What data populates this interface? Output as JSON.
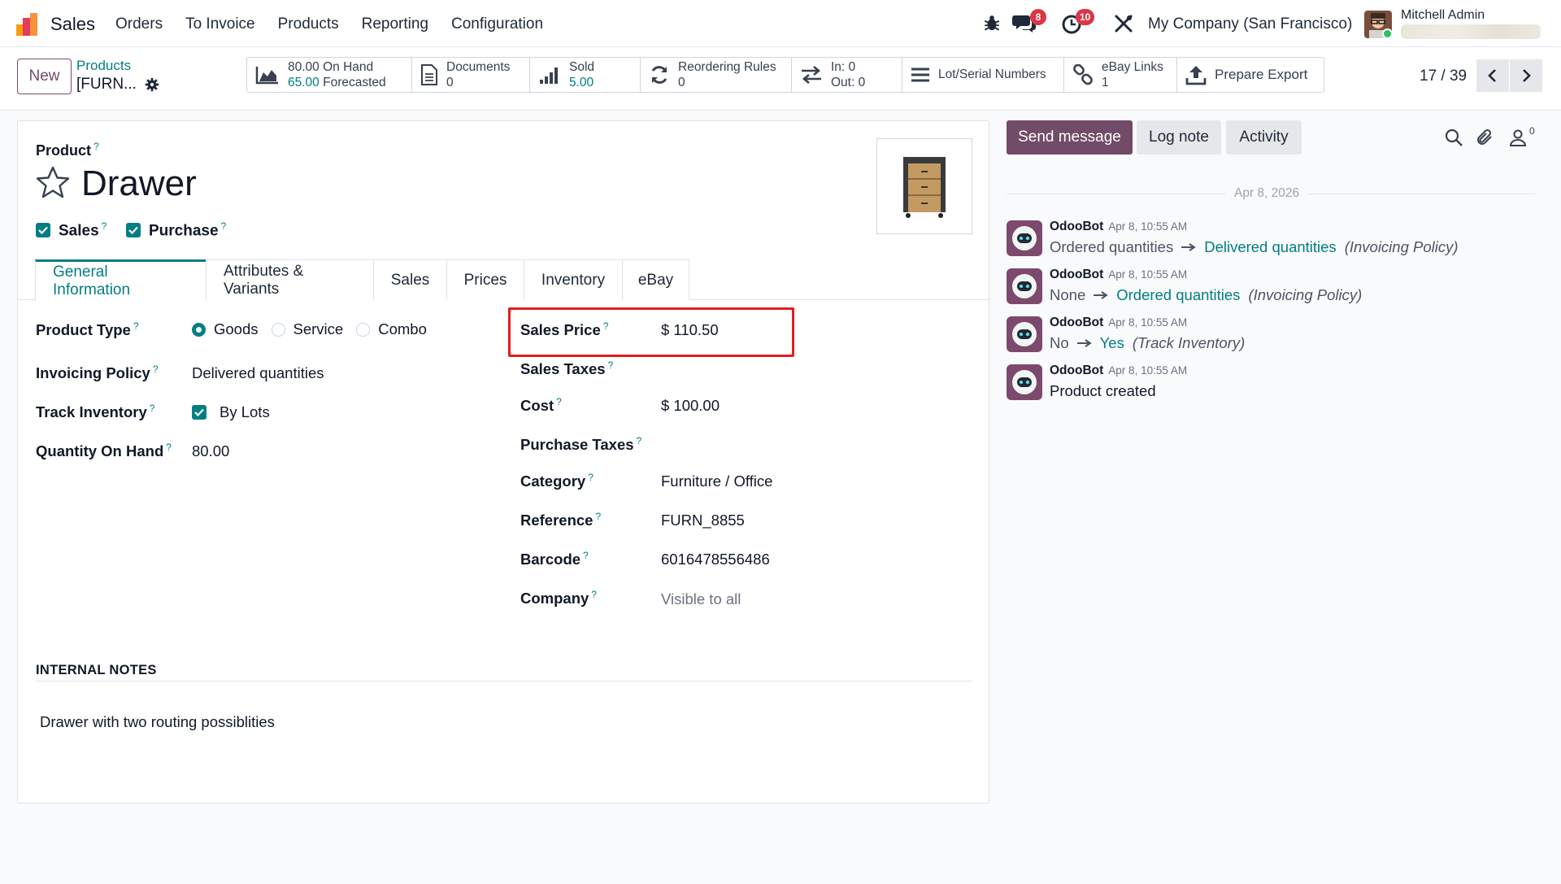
{
  "navbar": {
    "app_name": "Sales",
    "menu": [
      "Orders",
      "To Invoice",
      "Products",
      "Reporting",
      "Configuration"
    ],
    "messages_badge": "8",
    "activities_badge": "10",
    "company": "My Company (San Francisco)",
    "user_name": "Mitchell Admin"
  },
  "control": {
    "new_label": "New",
    "breadcrumb_parent": "Products",
    "breadcrumb_current": "[FURN...",
    "smart_buttons": {
      "on_hand": "80.00 On Hand",
      "forecasted_value": "65.00",
      "forecasted_label": "Forecasted",
      "documents_label": "Documents",
      "documents_count": "0",
      "sold_label": "Sold",
      "sold_value": "5.00",
      "reordering_label": "Reordering Rules",
      "reordering_count": "0",
      "in_label": "In: 0",
      "out_label": "Out: 0",
      "lot_label": "Lot/Serial Numbers",
      "ebay_label": "eBay Links",
      "ebay_count": "1",
      "export_label": "Prepare Export"
    },
    "pager": "17 / 39"
  },
  "form": {
    "product_label": "Product",
    "help_mark": "?",
    "title": "Drawer",
    "checkboxes": {
      "sales": "Sales",
      "purchase": "Purchase"
    },
    "tabs": [
      "General Information",
      "Attributes & Variants",
      "Sales",
      "Prices",
      "Inventory",
      "eBay"
    ],
    "active_tab": "General Information",
    "left_fields": {
      "product_type_label": "Product Type",
      "product_type_options": [
        "Goods",
        "Service",
        "Combo"
      ],
      "product_type_selected": "Goods",
      "invoicing_policy_label": "Invoicing Policy",
      "invoicing_policy_value": "Delivered quantities",
      "track_inventory_label": "Track Inventory",
      "track_inventory_value": "By Lots",
      "qty_on_hand_label": "Quantity On Hand",
      "qty_on_hand_value": "80.00"
    },
    "right_fields": {
      "sales_price_label": "Sales Price",
      "sales_price_value": "$ 110.50",
      "sales_taxes_label": "Sales Taxes",
      "cost_label": "Cost",
      "cost_value": "$ 100.00",
      "purchase_taxes_label": "Purchase Taxes",
      "category_label": "Category",
      "category_value": "Furniture / Office",
      "reference_label": "Reference",
      "reference_value": "FURN_8855",
      "barcode_label": "Barcode",
      "barcode_value": "6016478556486",
      "company_label": "Company",
      "company_value": "Visible to all"
    },
    "notes_heading": "INTERNAL NOTES",
    "notes_text": "Drawer with two routing possiblities"
  },
  "chatter": {
    "send_message": "Send message",
    "log_note": "Log note",
    "activity": "Activity",
    "followers_count": "0",
    "date_separator": "Apr 8, 2026",
    "messages": [
      {
        "author": "OdooBot",
        "date": "Apr 8, 10:55 AM",
        "old": "Ordered quantities",
        "new": "Delivered quantities",
        "field": "(Invoicing Policy)"
      },
      {
        "author": "OdooBot",
        "date": "Apr 8, 10:55 AM",
        "old": "None",
        "new": "Ordered quantities",
        "field": "(Invoicing Policy)"
      },
      {
        "author": "OdooBot",
        "date": "Apr 8, 10:55 AM",
        "old": "No",
        "new": "Yes",
        "field": "(Track Inventory)"
      },
      {
        "author": "OdooBot",
        "date": "Apr 8, 10:55 AM",
        "text": "Product created"
      }
    ]
  },
  "colors": {
    "brand": "#714b67",
    "accent_teal": "#017e84",
    "highlight_red": "#e11d20",
    "badge_red": "#dc3545"
  }
}
